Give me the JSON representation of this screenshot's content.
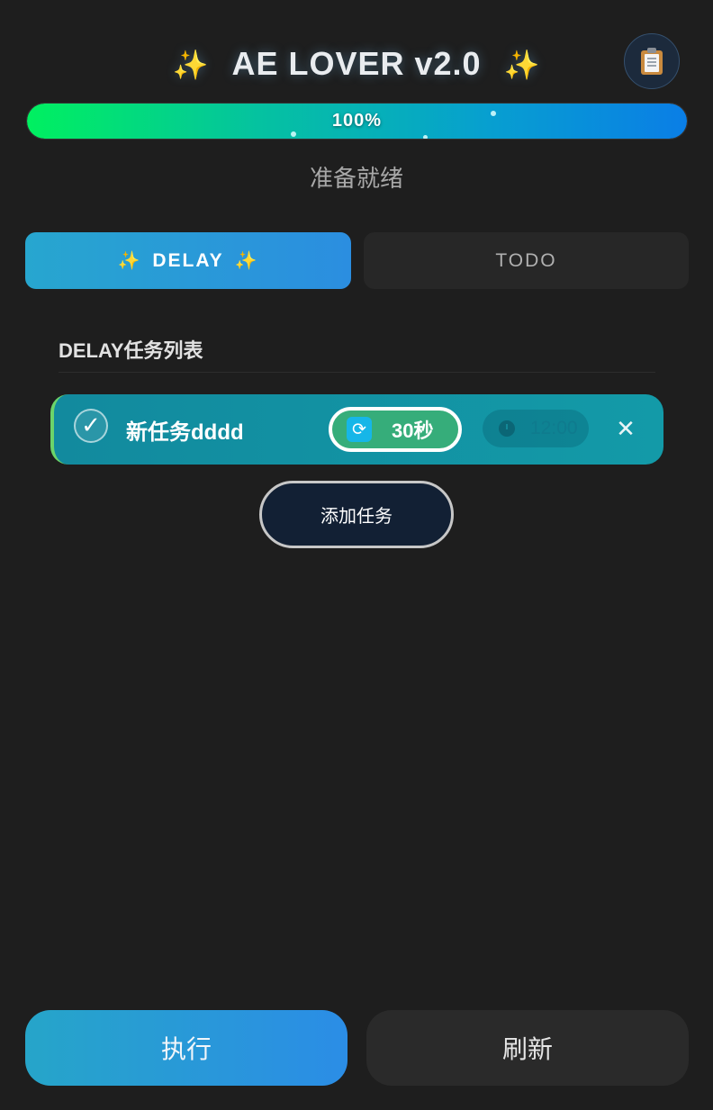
{
  "header": {
    "title": "AE LOVER v2.0",
    "sparkle": "✨",
    "clipboard_icon": "clipboard-icon"
  },
  "progress": {
    "value": 1.0,
    "label": "100%",
    "status": "准备就绪"
  },
  "tabs": [
    {
      "label": "DELAY",
      "active": true
    },
    {
      "label": "TODO",
      "active": false
    }
  ],
  "section": {
    "title": "DELAY任务列表"
  },
  "tasks": [
    {
      "checked": true,
      "check_glyph": "✓",
      "name": "新任务dddd",
      "delay_icon": "refresh-icon",
      "delay_glyph": "⟳",
      "delay": "30秒",
      "time_icon": "clock-icon",
      "time": "12:00",
      "delete_glyph": "✕"
    }
  ],
  "add_task_label": "添加任务",
  "footer": {
    "run_label": "执行",
    "refresh_label": "刷新"
  },
  "colors": {
    "background": "#1e1e1e",
    "accent": "#2b8ee0",
    "task_row": "#139aa8",
    "delay_pill": "#36ad7a",
    "progress_start": "#00f060",
    "progress_end": "#0a7ee6"
  }
}
